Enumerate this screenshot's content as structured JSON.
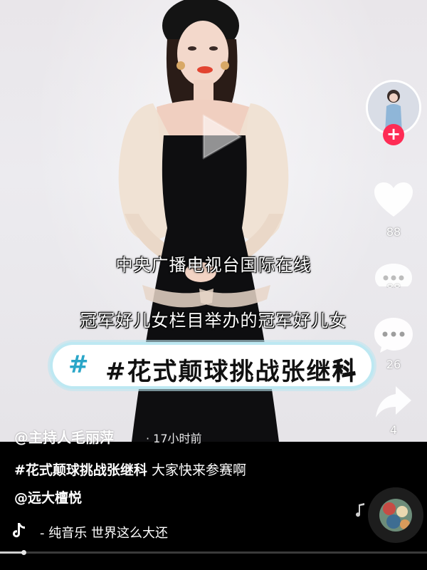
{
  "video": {
    "subtitle_1": "中央广播电视台国际在线",
    "subtitle_2": "冠军好儿女栏目举办的冠军好儿女",
    "banner": {
      "hash": "#",
      "text": "#花式颠球挑战张继科",
      "tail": "科"
    }
  },
  "rail": {
    "like_count": "88",
    "comment_count_ghost": "88",
    "comment_count": "26",
    "share_count": "4"
  },
  "post": {
    "author": "@主持人毛丽萍",
    "time": "· 17小时前",
    "caption_tag": "#花式颠球挑战张继科",
    "caption_text": " 大家快来参赛啊",
    "mention": "@远大檀悦",
    "music": "- 纯音乐    世界这么大还"
  },
  "progress": {
    "fraction": 0.055
  },
  "icons": [
    "play-icon",
    "like-icon",
    "comment-icon",
    "share-icon",
    "follow-plus-icon",
    "tiktok-note-icon",
    "music-disc-icon"
  ],
  "colors": {
    "accent": "#fe2c55",
    "banner_hash": "#2aa6c8",
    "banner_border": "#bde8f2"
  }
}
